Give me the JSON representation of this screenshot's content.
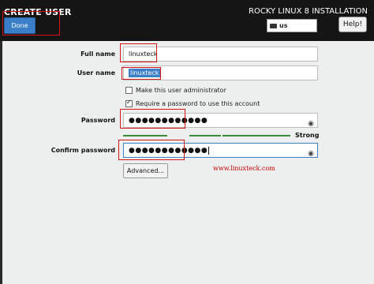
{
  "header": {
    "title": "CREATE USER",
    "installer_title": "ROCKY LINUX 8 INSTALLATION",
    "done_label": "Done",
    "keyboard_layout": "us",
    "help_label": "Help!"
  },
  "form": {
    "full_name_label": "Full name",
    "full_name_value": "linuxteck",
    "user_name_label": "User name",
    "user_name_value": "linuxteck",
    "admin_checkbox_label": "Make this user administrator",
    "admin_checked": false,
    "require_password_label": "Require a password to use this account",
    "require_password_checked": true,
    "password_label": "Password",
    "password_value": "●●●●●●●●●●●●",
    "strength_label": "Strong",
    "strength_level": 1.0,
    "confirm_label": "Confirm password",
    "confirm_value": "●●●●●●●●●●●●",
    "advanced_label": "Advanced..."
  },
  "watermark": "www.linuxteck.com",
  "icons": {
    "keyboard": "keyboard-icon",
    "eye": "eye-icon"
  },
  "colors": {
    "accent": "#3b7fc8",
    "highlight": "#d41515",
    "strength": "#3a8a3a"
  }
}
